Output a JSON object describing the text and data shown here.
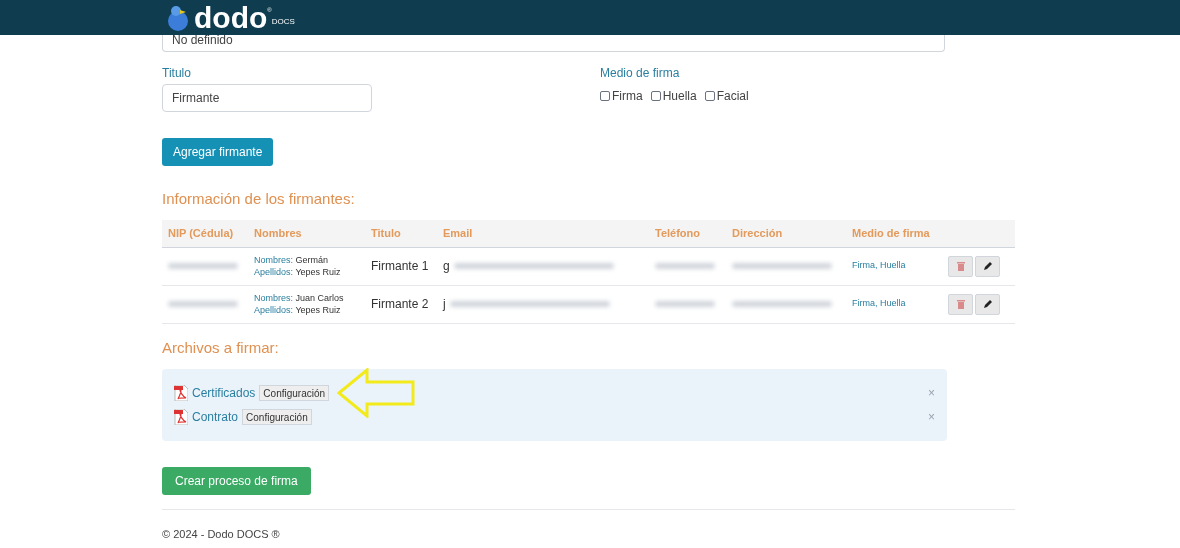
{
  "header": {
    "logo": "dodo",
    "logo_sub": "DOCS",
    "logo_mark": "®"
  },
  "top_field": {
    "value": "No definido"
  },
  "title_field": {
    "label": "Titulo",
    "value": "Firmante"
  },
  "signature_method": {
    "label": "Medio de firma",
    "options": [
      {
        "label": "Firma",
        "checked": false
      },
      {
        "label": "Huella",
        "checked": false
      },
      {
        "label": "Facial",
        "checked": false
      }
    ]
  },
  "add_button": "Agregar firmante",
  "signers_heading": "Información de los firmantes:",
  "table": {
    "columns": [
      "NIP (Cédula)",
      "Nombres",
      "Titulo",
      "Email",
      "Teléfono",
      "Dirección",
      "Medio de firma"
    ],
    "rows": [
      {
        "first_label": "Nombres:",
        "first": "Germán",
        "last_label": "Apellidos:",
        "last": "Yepes Ruiz",
        "title": "Firmante 1",
        "email_start": "g",
        "method": "Firma, Huella"
      },
      {
        "first_label": "Nombres:",
        "first": "Juan Carlos",
        "last_label": "Apellidos:",
        "last": "Yepes Ruiz",
        "title": "Firmante 2",
        "email_start": "j",
        "method": "Firma, Huella"
      }
    ]
  },
  "files_heading": "Archivos a firmar:",
  "files": [
    {
      "name": "Certificados",
      "config": "Configuración",
      "highlighted": true,
      "remove": "×"
    },
    {
      "name": "Contrato",
      "config": "Configuración",
      "highlighted": false,
      "remove": "×"
    }
  ],
  "create_button": "Crear proceso de firma",
  "footer": "© 2024 - Dodo DOCS ®"
}
